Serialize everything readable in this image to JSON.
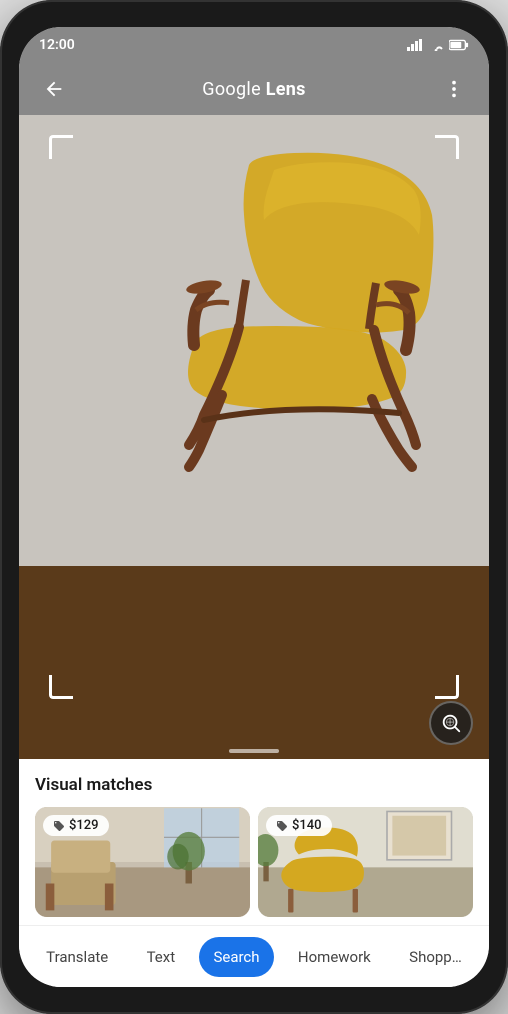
{
  "status_bar": {
    "time": "12:00",
    "signal_icon": "signal",
    "wifi_icon": "wifi",
    "battery_icon": "battery"
  },
  "app_bar": {
    "back_icon": "back-arrow",
    "title_plain": "Google ",
    "title_bold": "Lens",
    "menu_icon": "more-options"
  },
  "camera": {
    "lens_search_icon": "lens-search"
  },
  "results": {
    "section_title": "Visual matches",
    "matches": [
      {
        "price": "$129"
      },
      {
        "price": "$140"
      }
    ]
  },
  "tabs": [
    {
      "id": "translate",
      "label": "Translate",
      "active": false
    },
    {
      "id": "text",
      "label": "Text",
      "active": false
    },
    {
      "id": "search",
      "label": "Search",
      "active": true
    },
    {
      "id": "homework",
      "label": "Homework",
      "active": false
    },
    {
      "id": "shopping",
      "label": "Shopp…",
      "active": false
    }
  ]
}
